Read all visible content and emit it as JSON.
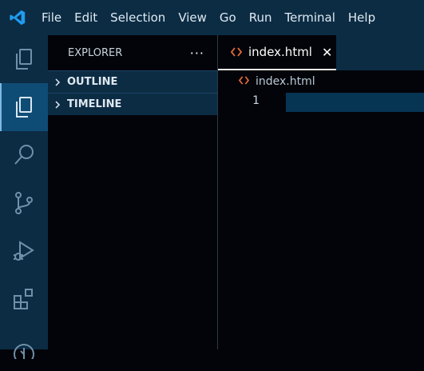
{
  "menu": {
    "file": "File",
    "edit": "Edit",
    "selection": "Selection",
    "view": "View",
    "go": "Go",
    "run": "Run",
    "terminal": "Terminal",
    "help": "Help"
  },
  "activity_bar": {
    "items": [
      "files-icon",
      "explorer-icon",
      "search-icon",
      "source-control-icon",
      "run-debug-icon",
      "extensions-icon",
      "remote-icon"
    ],
    "active": "explorer-icon"
  },
  "sidebar": {
    "title": "EXPLORER",
    "more": "···",
    "sections": [
      {
        "label": "OUTLINE"
      },
      {
        "label": "TIMELINE"
      }
    ]
  },
  "editor": {
    "tab": {
      "label": "index.html",
      "close": "✕"
    },
    "breadcrumb": "index.html",
    "line_number": "1"
  },
  "colors": {
    "accent": "#0c2c44",
    "html_icon": "#e96a3a",
    "active_item": "#0f4c75"
  }
}
